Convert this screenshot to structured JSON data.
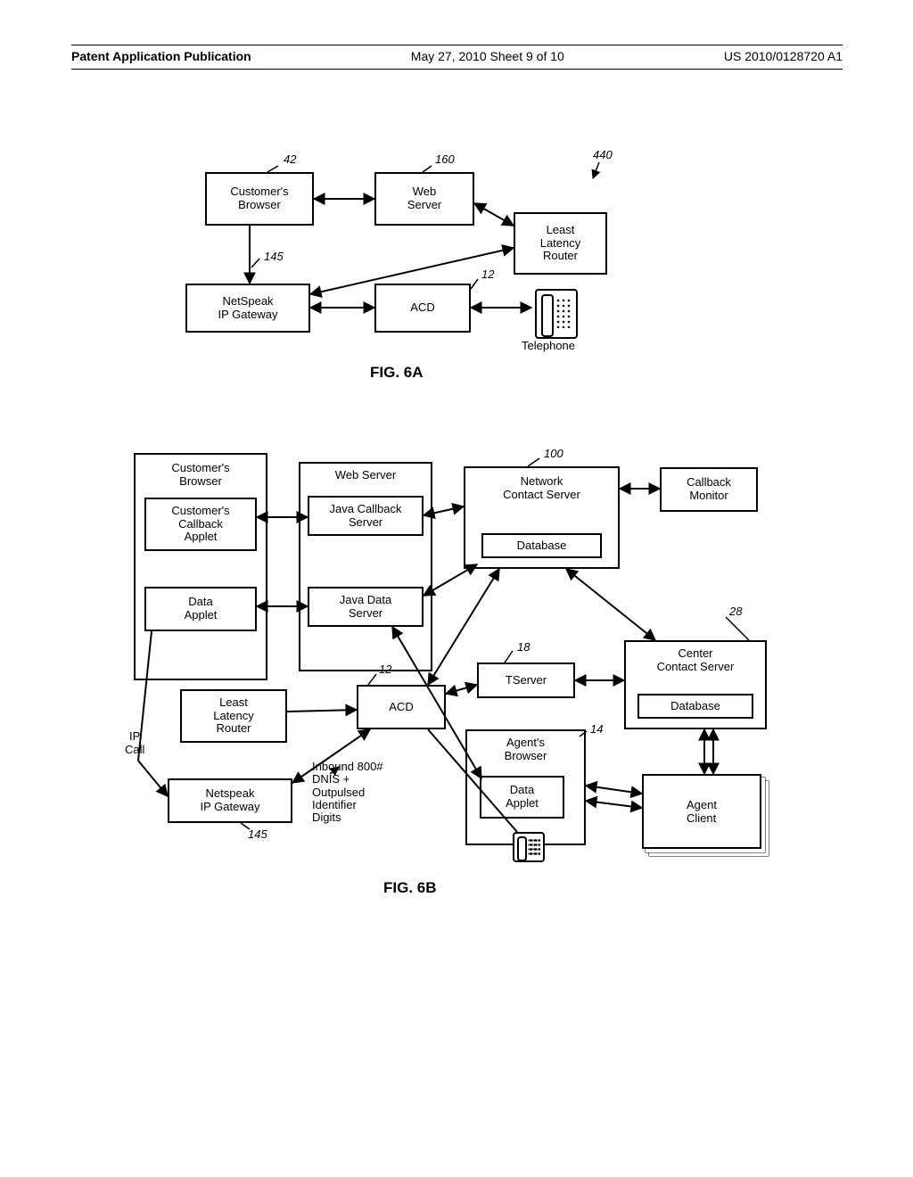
{
  "header": {
    "left": "Patent Application Publication",
    "mid": "May 27, 2010  Sheet 9 of 10",
    "right": "US 2010/0128720 A1"
  },
  "fig6a": {
    "caption": "FIG. 6A",
    "boxes": {
      "customers_browser": "Customer's\nBrowser",
      "web_server": "Web\nServer",
      "least_latency_router": "Least\nLatency\nRouter",
      "netspeak_ip_gateway": "NetSpeak\nIP Gateway",
      "acd": "ACD",
      "telephone_label": "Telephone"
    },
    "refs": {
      "ref42": "42",
      "ref160": "160",
      "ref440": "440",
      "ref145": "145",
      "ref12": "12"
    }
  },
  "fig6b": {
    "caption": "FIG. 6B",
    "boxes": {
      "customers_browser": "Customer's\nBrowser",
      "customers_callback_applet": "Customer's\nCallback\nApplet",
      "data_applet": "Data\nApplet",
      "web_server": "Web Server",
      "java_callback_server": "Java Callback\nServer",
      "java_data_server": "Java Data\nServer",
      "network_contact_server": "Network\nContact Server",
      "database1": "Database",
      "callback_monitor": "Callback\nMonitor",
      "least_latency_router": "Least\nLatency\nRouter",
      "acd": "ACD",
      "tserver": "TServer",
      "center_contact_server": "Center\nContact Server",
      "database2": "Database",
      "agents_browser": "Agent's\nBrowser",
      "data_applet2": "Data\nApplet",
      "netspeak_ip_gateway": "Netspeak\nIP Gateway",
      "agent_client": "Agent\nClient",
      "ip_call": "IP\nCall",
      "inbound": "Inbound 800#\nDNIS +\nOutpulsed\nIdentifier\nDigits"
    },
    "refs": {
      "ref100": "100",
      "ref28": "28",
      "ref18": "18",
      "ref12": "12",
      "ref14": "14",
      "ref145": "145"
    }
  }
}
